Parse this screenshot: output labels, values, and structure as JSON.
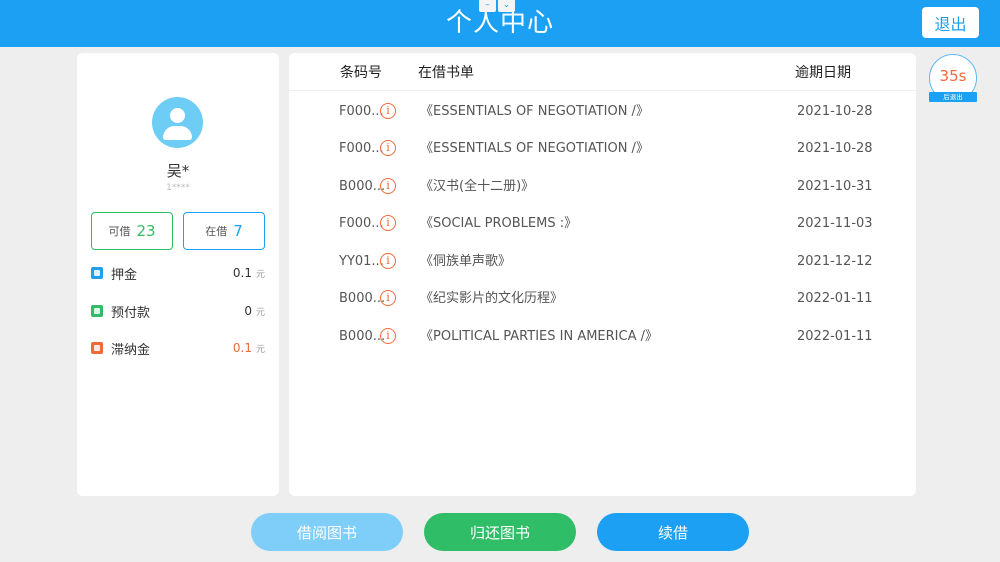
{
  "header": {
    "title": "个人中心",
    "logout_label": "退出",
    "win_min": "–",
    "win_down": "⌄"
  },
  "user": {
    "name": "吴*",
    "id": "1****"
  },
  "counts": {
    "available_label": "可借",
    "available_value": "23",
    "borrowed_label": "在借",
    "borrowed_value": "7"
  },
  "finance": [
    {
      "label": "押金",
      "value": "0.1",
      "unit": "元",
      "color": "#1ca0f3",
      "icon": "deposit-icon"
    },
    {
      "label": "预付款",
      "value": "0",
      "unit": "元",
      "color": "#2fbe67",
      "icon": "prepayment-icon"
    },
    {
      "label": "滞纳金",
      "value": "0.1",
      "unit": "元",
      "color": "#f06a3a",
      "icon": "late-fee-icon"
    }
  ],
  "table": {
    "headers": {
      "barcode": "条码号",
      "title": "在借书单",
      "due": "逾期日期"
    },
    "rows": [
      {
        "barcode": "F000...",
        "title": "《ESSENTIALS OF NEGOTIATION /》",
        "due": "2021-10-28"
      },
      {
        "barcode": "F000...",
        "title": "《ESSENTIALS OF NEGOTIATION /》",
        "due": "2021-10-28"
      },
      {
        "barcode": "B000...",
        "title": "《汉书(全十二册)》",
        "due": "2021-10-31"
      },
      {
        "barcode": "F000...",
        "title": "《SOCIAL PROBLEMS :》",
        "due": "2021-11-03"
      },
      {
        "barcode": "YY01...",
        "title": "《侗族单声歌》",
        "due": "2021-12-12"
      },
      {
        "barcode": "B000...",
        "title": "《纪实影片的文化历程》",
        "due": "2022-01-11"
      },
      {
        "barcode": "B000...",
        "title": "《POLITICAL PARTIES IN AMERICA /》",
        "due": "2022-01-11"
      }
    ]
  },
  "timer": {
    "value": "35s",
    "tag": "后退出"
  },
  "actions": {
    "borrow": "借阅图书",
    "return": "归还图书",
    "renew": "续借"
  }
}
